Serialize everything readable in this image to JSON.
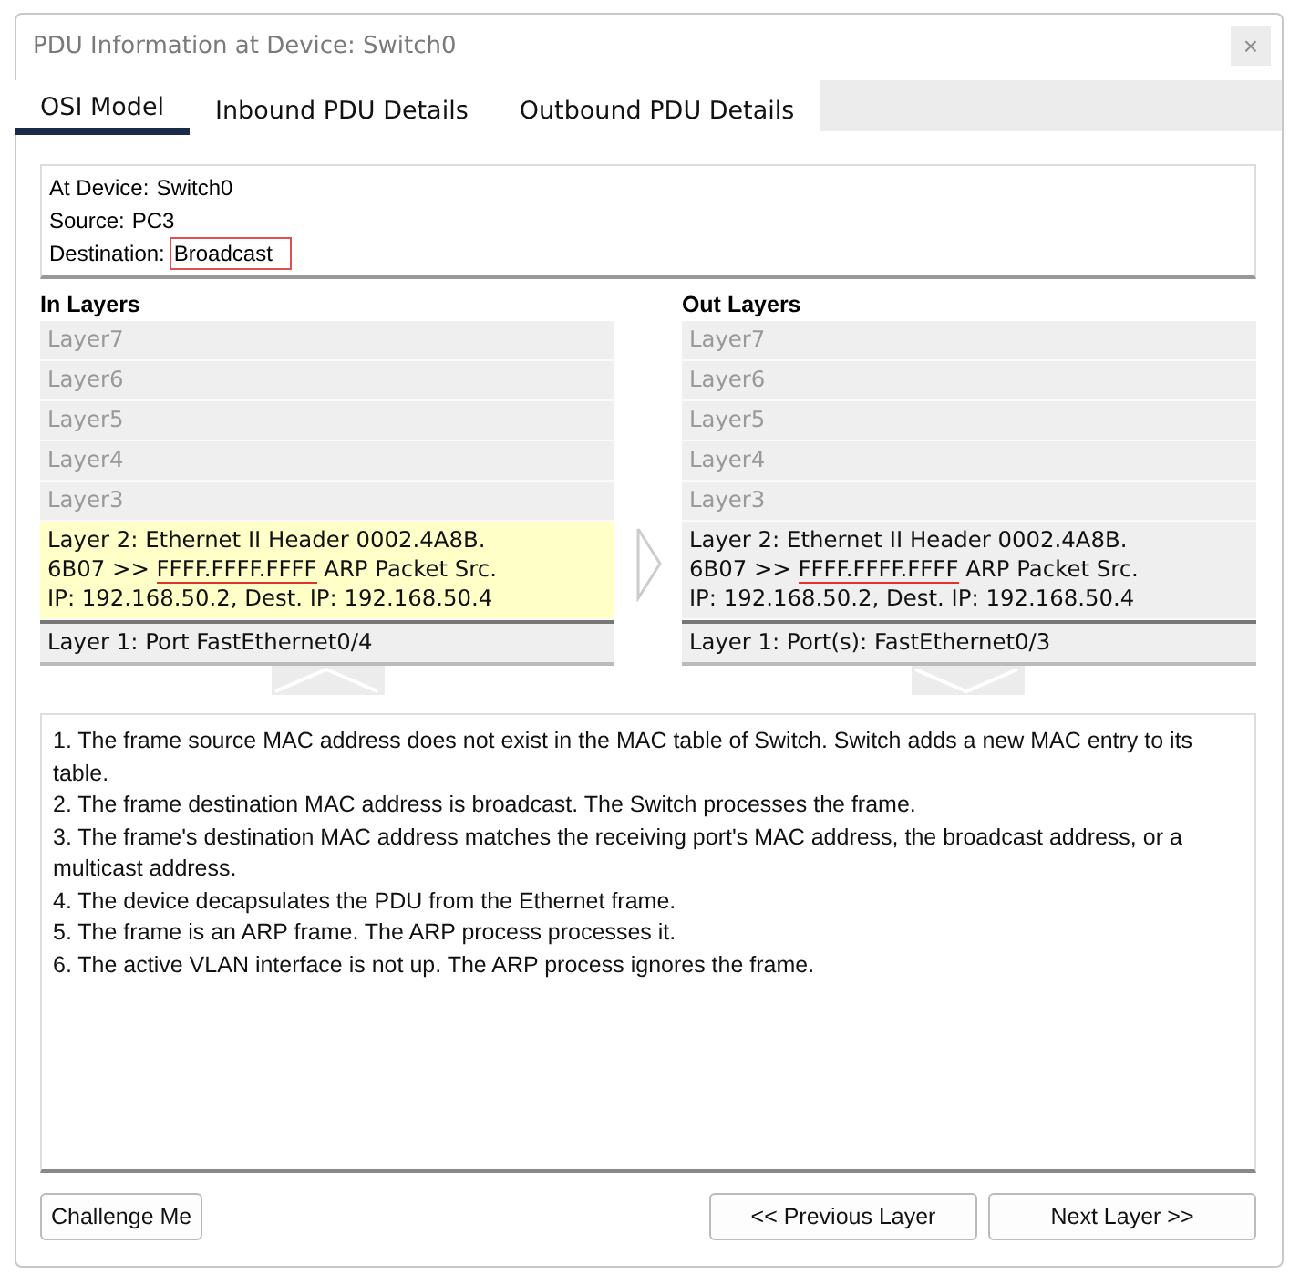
{
  "window": {
    "title": "PDU Information at Device: Switch0",
    "close": "×"
  },
  "tabs": [
    {
      "label": "OSI Model",
      "selected": true
    },
    {
      "label": "Inbound PDU Details",
      "selected": false
    },
    {
      "label": "Outbound PDU Details",
      "selected": false
    }
  ],
  "info": {
    "lines": [
      {
        "label": "At Device:",
        "value": "Switch0",
        "boxed": false
      },
      {
        "label": "Source:",
        "value": "PC3",
        "boxed": false
      },
      {
        "label": "Destination:",
        "value": "Broadcast",
        "boxed": true
      }
    ]
  },
  "in_layers": {
    "title": "In Layers",
    "kind": "up",
    "layers": [
      {
        "lines": [
          {
            "text": "Layer7"
          }
        ],
        "disabled": true,
        "selected": false
      },
      {
        "lines": [
          {
            "text": "Layer6"
          }
        ],
        "disabled": true,
        "selected": false
      },
      {
        "lines": [
          {
            "text": "Layer5"
          }
        ],
        "disabled": true,
        "selected": false
      },
      {
        "lines": [
          {
            "text": "Layer4"
          }
        ],
        "disabled": true,
        "selected": false
      },
      {
        "lines": [
          {
            "text": "Layer3"
          }
        ],
        "disabled": true,
        "selected": false
      },
      {
        "lines": [
          {
            "text": "Layer 2: Ethernet II Header 0002.4A8B."
          },
          {
            "text": "6B07 >> ",
            "underlined": "FFFF.FFFF.FFFF",
            "after": " ARP Packet Src."
          },
          {
            "text": "IP: 192.168.50.2, Dest. IP: 192.168.50.4"
          }
        ],
        "disabled": false,
        "selected": true
      },
      {
        "lines": [
          {
            "text": "Layer 1: Port FastEthernet0/4"
          }
        ],
        "disabled": false,
        "selected": false
      }
    ]
  },
  "out_layers": {
    "title": "Out Layers",
    "kind": "down",
    "layers": [
      {
        "lines": [
          {
            "text": "Layer7"
          }
        ],
        "disabled": true,
        "selected": false
      },
      {
        "lines": [
          {
            "text": "Layer6"
          }
        ],
        "disabled": true,
        "selected": false
      },
      {
        "lines": [
          {
            "text": "Layer5"
          }
        ],
        "disabled": true,
        "selected": false
      },
      {
        "lines": [
          {
            "text": "Layer4"
          }
        ],
        "disabled": true,
        "selected": false
      },
      {
        "lines": [
          {
            "text": "Layer3"
          }
        ],
        "disabled": true,
        "selected": false
      },
      {
        "lines": [
          {
            "text": "Layer 2: Ethernet II Header 0002.4A8B."
          },
          {
            "text": "6B07 >> ",
            "underlined": "FFFF.FFFF.FFFF",
            "after": " ARP Packet Src."
          },
          {
            "text": "IP: 192.168.50.2, Dest. IP: 192.168.50.4"
          }
        ],
        "disabled": false,
        "selected": false
      },
      {
        "lines": [
          {
            "text": "Layer 1: Port(s): FastEthernet0/3"
          }
        ],
        "disabled": false,
        "selected": false
      }
    ]
  },
  "description": [
    "1. The frame source MAC address does not exist in the MAC table of Switch. Switch adds a new MAC entry to its table.",
    "2. The frame destination MAC address is broadcast. The Switch processes the frame.",
    "3. The frame's destination MAC address matches the receiving port's MAC address, the broadcast address, or a multicast address.",
    "4. The device decapsulates the PDU from the Ethernet frame.",
    "5. The frame is an ARP frame. The ARP process processes it.",
    "6. The active VLAN interface is not up. The ARP process ignores the frame."
  ],
  "buttons": {
    "challenge": "Challenge Me",
    "previous": "<< Previous Layer",
    "next": "Next Layer >>"
  }
}
